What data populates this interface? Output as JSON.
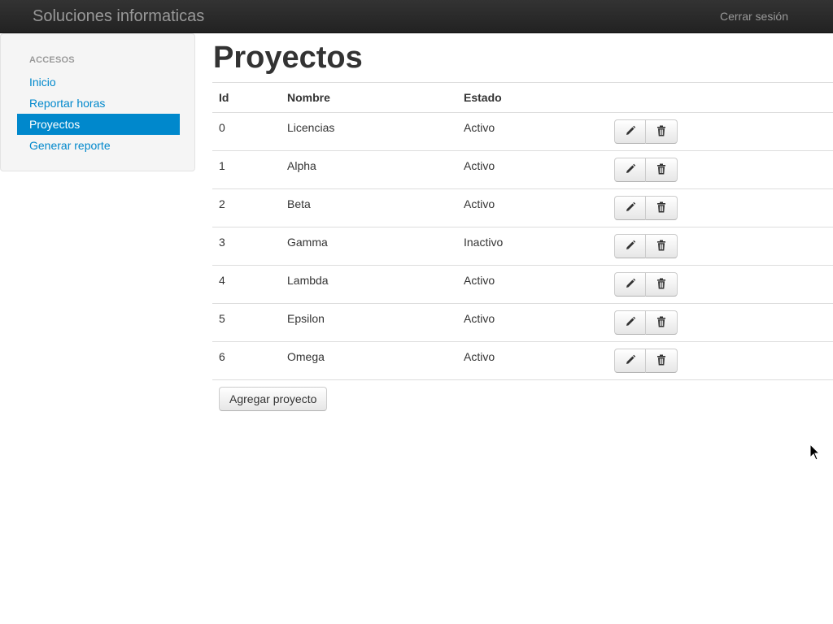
{
  "navbar": {
    "brand": "Soluciones informaticas",
    "logout_label": "Cerrar sesión"
  },
  "sidebar": {
    "header": "ACCESOS",
    "items": [
      {
        "label": "Inicio",
        "active": false
      },
      {
        "label": "Reportar horas",
        "active": false
      },
      {
        "label": "Proyectos",
        "active": true
      },
      {
        "label": "Generar reporte",
        "active": false
      }
    ]
  },
  "main": {
    "title": "Proyectos",
    "table": {
      "headers": {
        "id": "Id",
        "name": "Nombre",
        "state": "Estado"
      },
      "rows": [
        {
          "id": "0",
          "name": "Licencias",
          "state": "Activo"
        },
        {
          "id": "1",
          "name": "Alpha",
          "state": "Activo"
        },
        {
          "id": "2",
          "name": "Beta",
          "state": "Activo"
        },
        {
          "id": "3",
          "name": "Gamma",
          "state": "Inactivo"
        },
        {
          "id": "4",
          "name": "Lambda",
          "state": "Activo"
        },
        {
          "id": "5",
          "name": "Epsilon",
          "state": "Activo"
        },
        {
          "id": "6",
          "name": "Omega",
          "state": "Activo"
        }
      ],
      "row_actions": [
        "pencil-icon",
        "trash-icon"
      ]
    },
    "add_button_label": "Agregar proyecto"
  },
  "colors": {
    "navbar_bg": "#222222",
    "link": "#0088cc",
    "active_bg": "#0088cc",
    "sidebar_bg": "#f5f5f5"
  }
}
